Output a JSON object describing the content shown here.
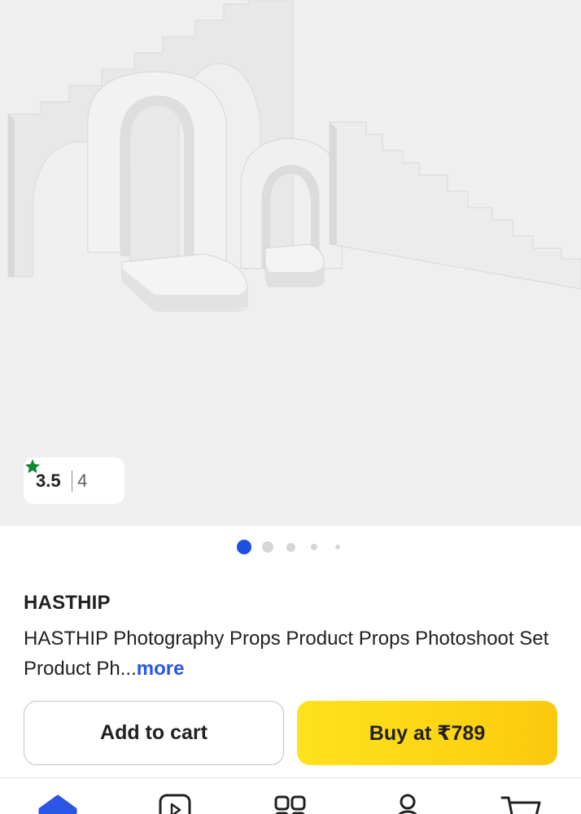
{
  "product_image": {
    "alt": "",
    "icon": "product-photo-arches-stairs-props"
  },
  "rating": {
    "value": "3.5",
    "count": "4",
    "star_color": "#108934"
  },
  "carousel": {
    "total": 5,
    "active_index": 0,
    "active_color": "#1e4fdf"
  },
  "product": {
    "brand": "HASTHIP",
    "title": "HASTHIP Photography Props Product Props Photoshoot Set Product Ph...",
    "more_label": "more"
  },
  "actions": {
    "add_to_cart_label": "Add to cart",
    "buy_label": "Buy at ₹789",
    "buy_color": "#fcd514"
  },
  "bottom_nav": {
    "items": [
      {
        "icon": "home-icon",
        "active": true,
        "color": "#2a55e5"
      },
      {
        "icon": "play-icon",
        "active": false
      },
      {
        "icon": "categories-icon",
        "active": false
      },
      {
        "icon": "account-icon",
        "active": false
      },
      {
        "icon": "cart-icon",
        "active": false
      }
    ]
  }
}
